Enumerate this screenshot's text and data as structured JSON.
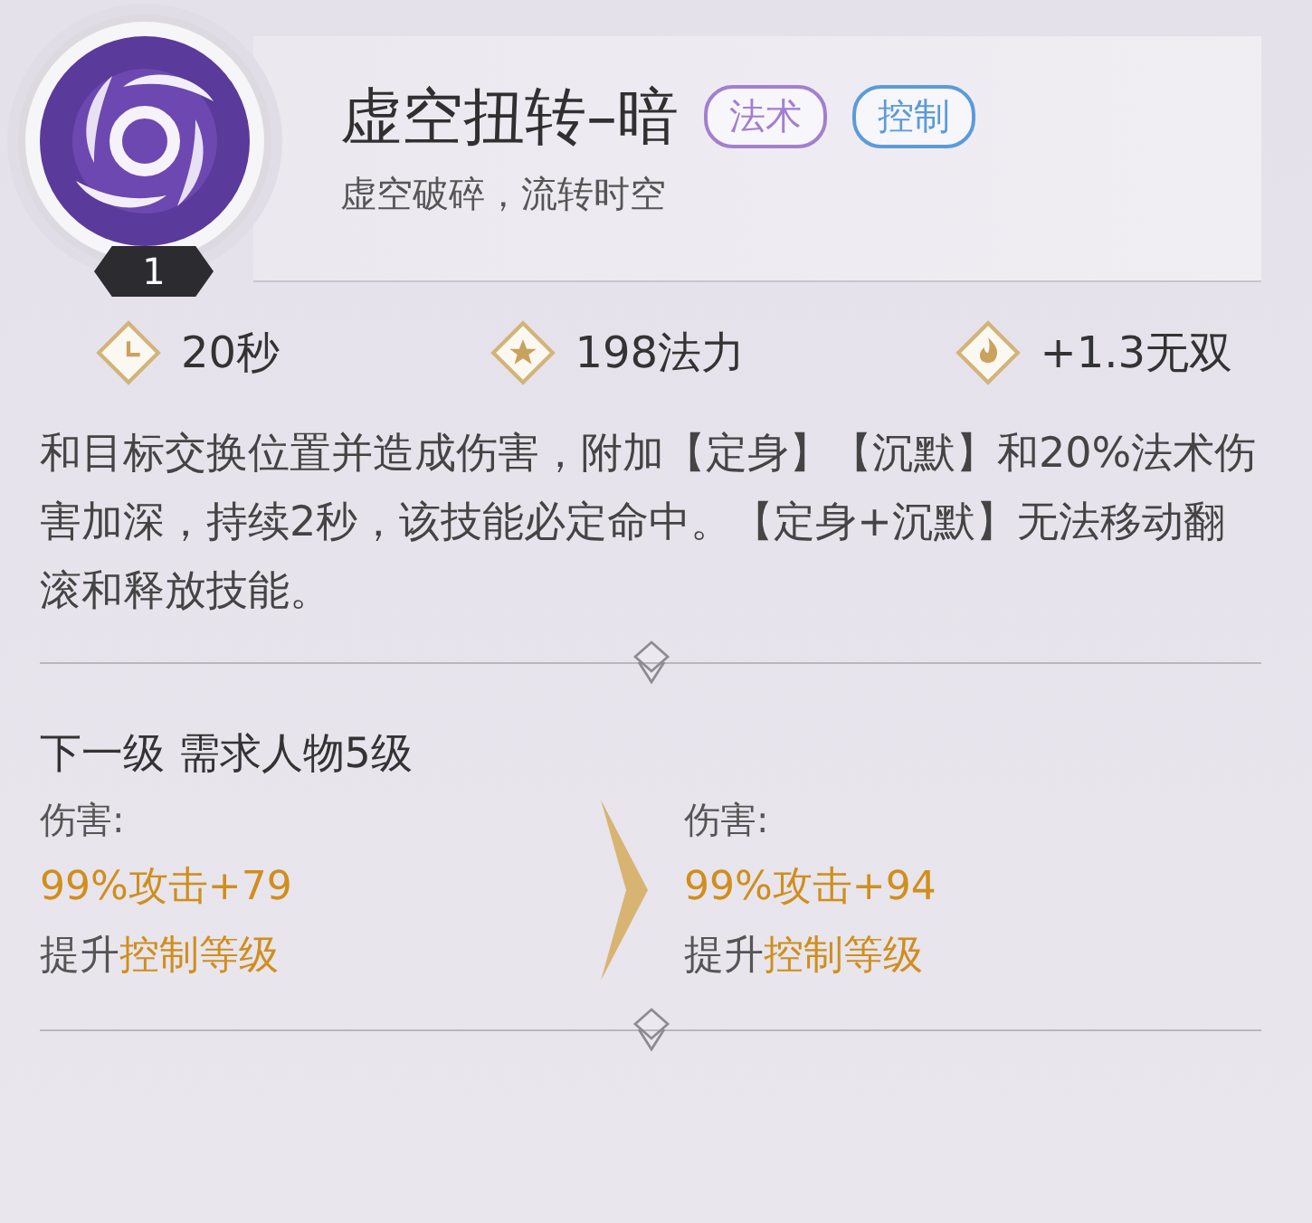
{
  "skill": {
    "name": "虚空扭转–暗",
    "subtitle": "虚空破碎，流转时空",
    "level": "1",
    "tags": [
      {
        "label": "法术",
        "color": "#a27fcf"
      },
      {
        "label": "控制",
        "color": "#5b9bd9"
      }
    ]
  },
  "stats": [
    {
      "kind": "clock",
      "text": "20秒"
    },
    {
      "kind": "star",
      "text": "198法力"
    },
    {
      "kind": "flame",
      "text": "+1.3无双"
    }
  ],
  "description": "和目标交换位置并造成伤害，附加【定身】【沉默】和20%法术伤害加深，持续2秒，该技能必定命中。【定身+沉默】无法移动翻滚和释放技能。",
  "next_level": {
    "title": "下一级 需求人物5级",
    "columns": [
      {
        "label": "伤害:",
        "value": "99%攻击+79",
        "upgrade": "提升**控制等级**"
      },
      {
        "label": "伤害:",
        "value": "99%攻击+94",
        "upgrade": "提升**控制等级**"
      }
    ]
  }
}
